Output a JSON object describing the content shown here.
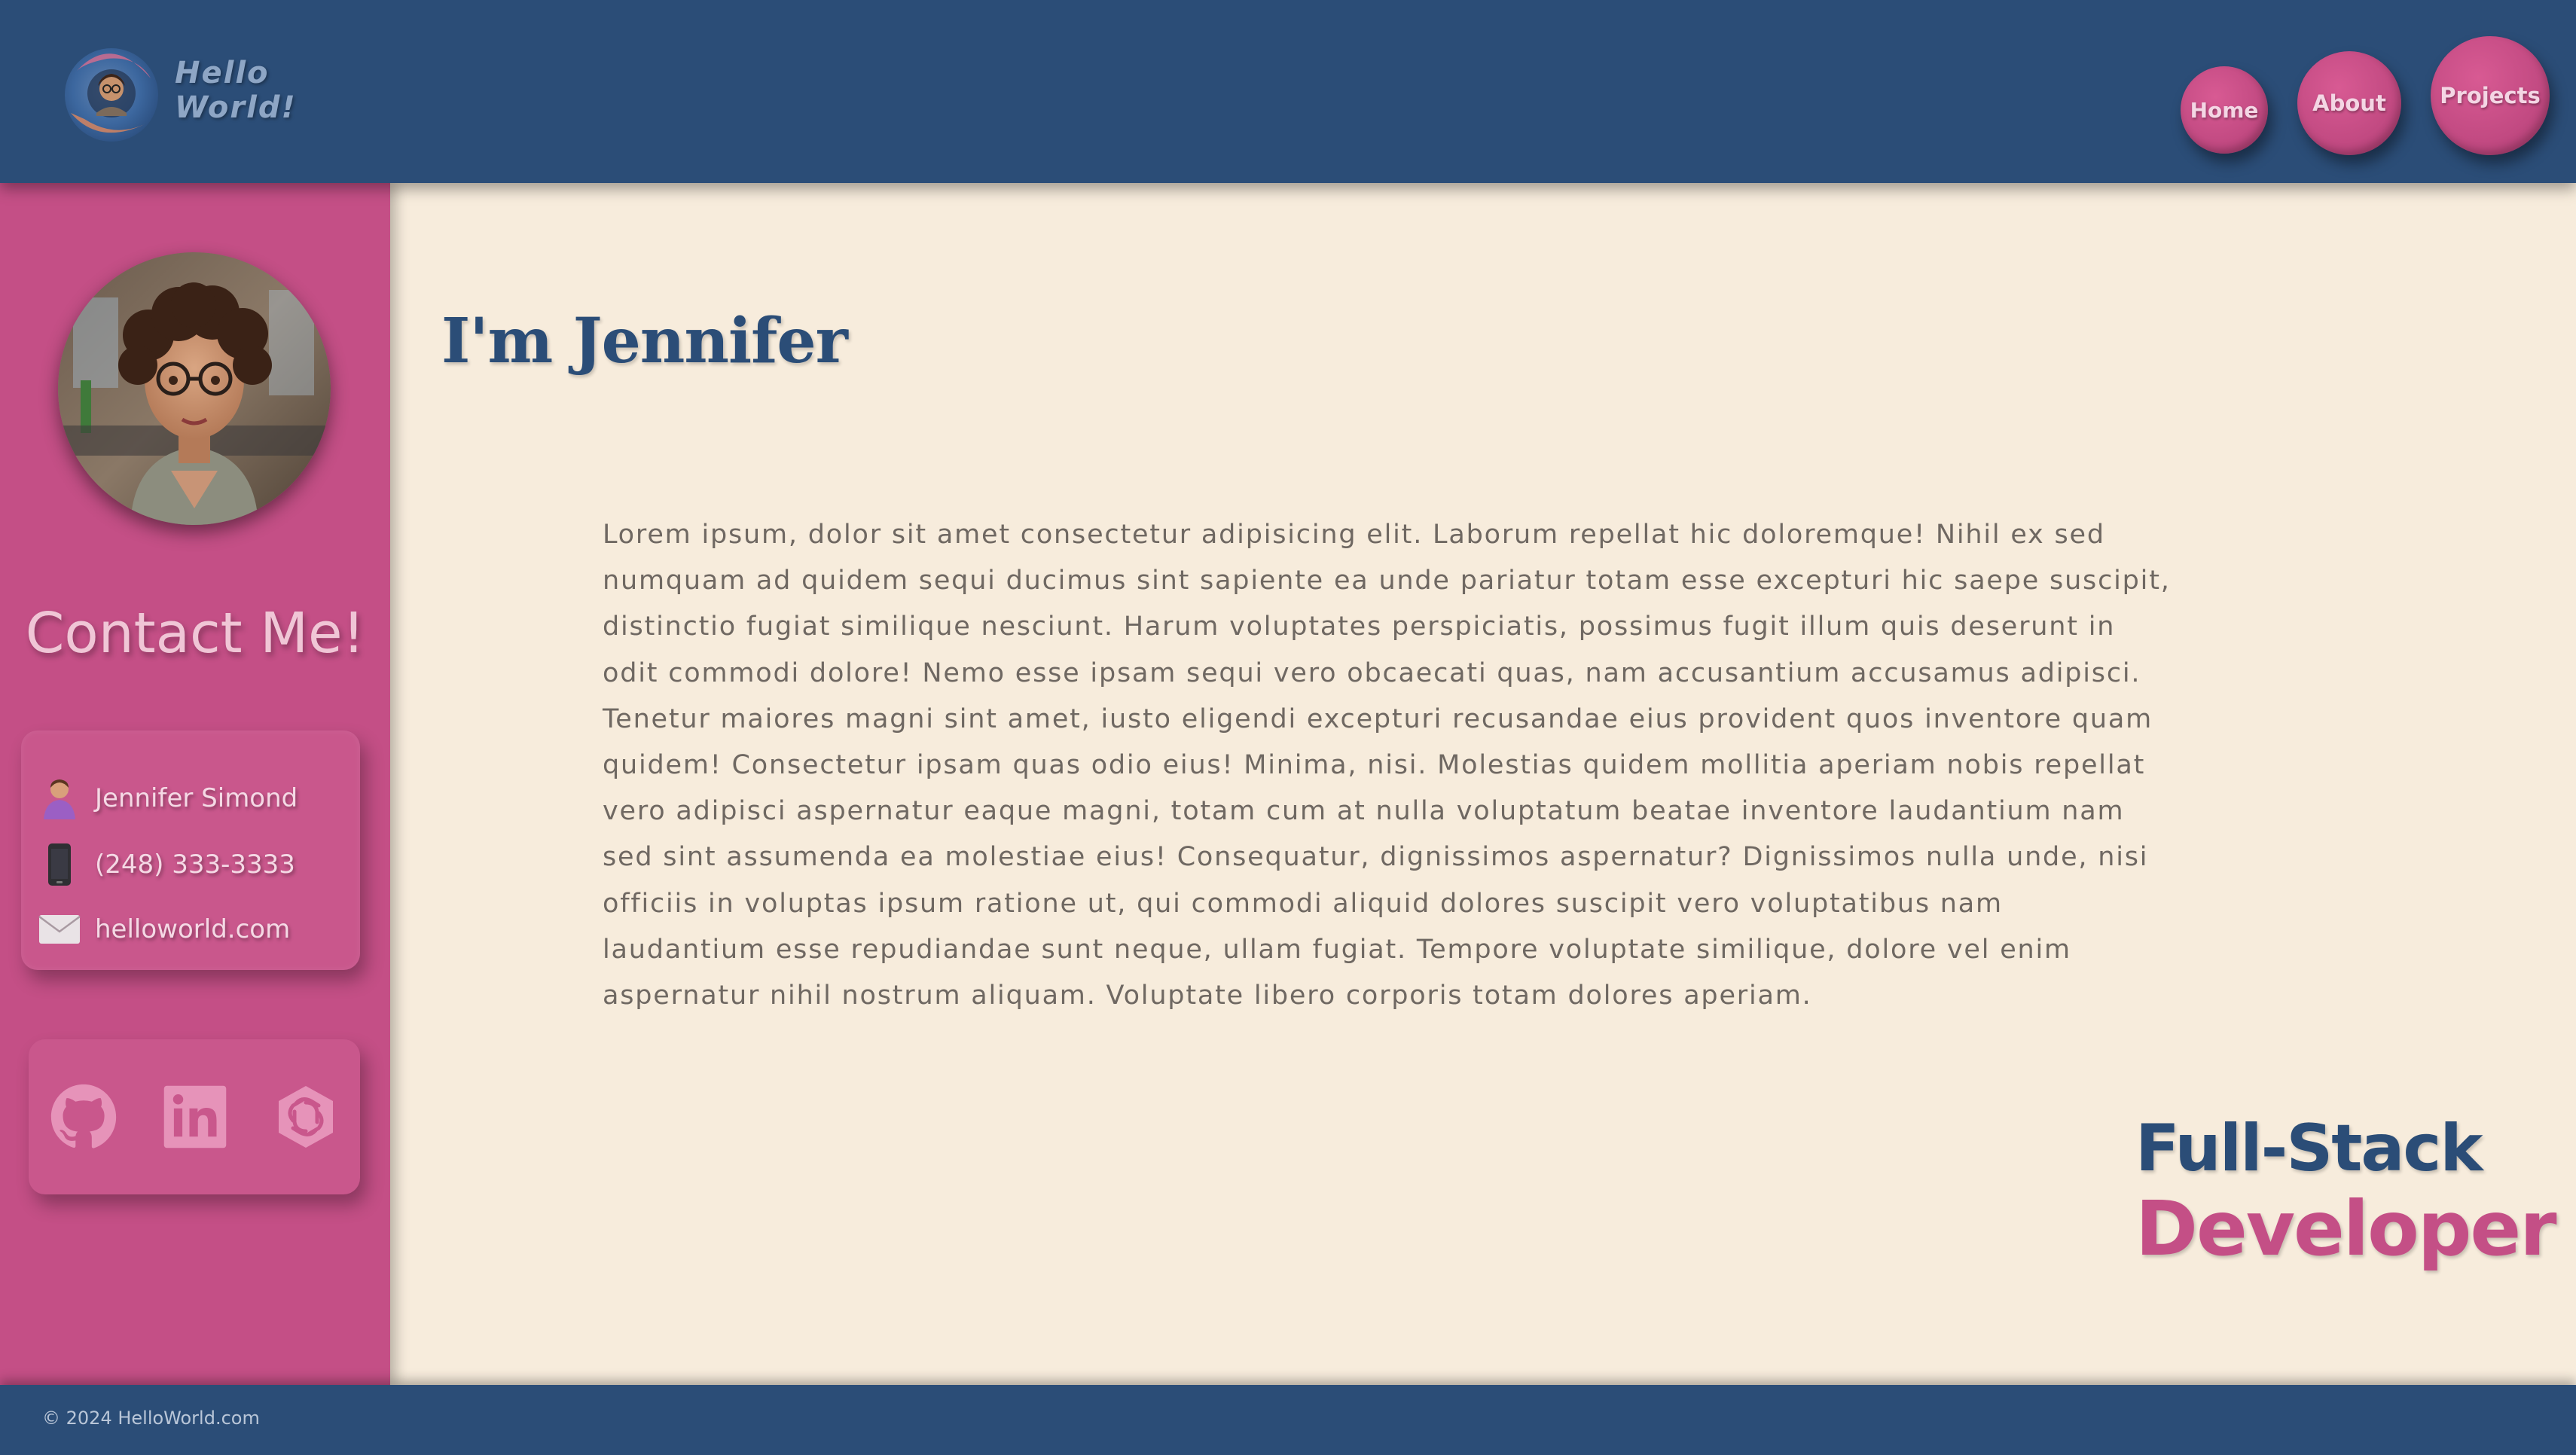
{
  "header": {
    "logo_text_line1": "Hello",
    "logo_text_line2": "World!",
    "nav": [
      {
        "label": "Home"
      },
      {
        "label": "About"
      },
      {
        "label": "Projects"
      }
    ]
  },
  "sidebar": {
    "avatar_icon": "profile-avatar",
    "contact_title": "Contact Me!",
    "contact": {
      "name": "Jennifer Simond",
      "name_icon": "person-icon",
      "phone": "(248) 333-3333",
      "phone_icon": "mobile-phone-icon",
      "email": "helloworld.com",
      "email_icon": "envelope-icon"
    },
    "social": [
      {
        "icon": "github-icon"
      },
      {
        "icon": "linkedin-icon"
      },
      {
        "icon": "openai-icon"
      }
    ]
  },
  "main": {
    "heading": "I'm Jennifer",
    "bio_lines": [
      "Lorem ipsum, dolor sit amet consectetur adipisicing elit. Laborum repellat hic doloremque! Nihil ex sed",
      "numquam ad quidem sequi ducimus sint sapiente ea unde pariatur totam esse excepturi hic saepe suscipit,",
      "distinctio fugiat similique nesciunt. Harum voluptates perspiciatis, possimus fugit illum quis deserunt in",
      "odit commodi dolore! Nemo esse ipsam sequi vero obcaecati quas, nam accusantium accusamus adipisci.",
      "Tenetur maiores magni sint amet, iusto eligendi excepturi recusandae eius provident quos inventore quam",
      "quidem! Consectetur ipsam quas odio eius! Minima, nisi. Molestias quidem mollitia aperiam nobis repellat",
      "vero adipisci aspernatur eaque magni, totam cum at nulla voluptatum beatae inventore laudantium nam",
      "sed sint assumenda ea molestiae eius! Consequatur, dignissimos aspernatur? Dignissimos nulla unde, nisi",
      "officiis in voluptas ipsum ratione ut, qui commodi aliquid dolores suscipit vero voluptatibus nam",
      "laudantium esse repudiandae sunt neque, ullam fugiat. Tempore voluptate similique, dolore vel enim",
      "aspernatur nihil nostrum aliquam. Voluptate libero corporis totam dolores aperiam."
    ],
    "role_line1": "Full-Stack",
    "role_line2": "Developer"
  },
  "footer": {
    "copyright": "© 2024 HelloWorld.com"
  },
  "colors": {
    "navy": "#2b4d77",
    "pink": "#c44f86",
    "cream": "#f7ecdc",
    "body_text": "#6f6862"
  }
}
